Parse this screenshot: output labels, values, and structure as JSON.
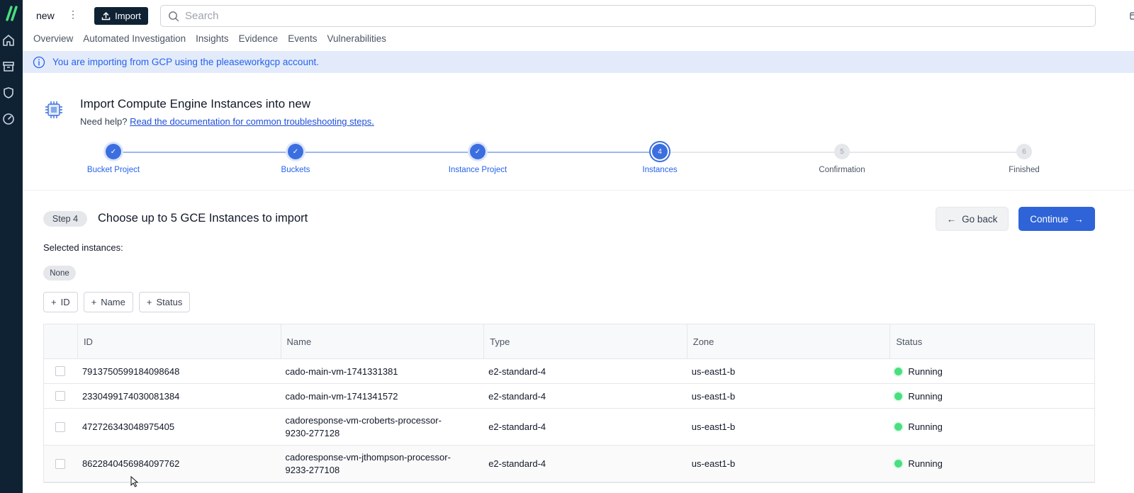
{
  "sidebar": {
    "logo_icon": "cado-logo-icon",
    "items": [
      {
        "icon": "home-icon"
      },
      {
        "icon": "archive-icon"
      },
      {
        "icon": "shield-icon"
      },
      {
        "icon": "gauge-icon"
      }
    ]
  },
  "topbar": {
    "workspace": "new",
    "import_label": "Import",
    "search_placeholder": "Search"
  },
  "tabs": [
    "Overview",
    "Automated Investigation",
    "Insights",
    "Evidence",
    "Events",
    "Vulnerabilities"
  ],
  "banner": {
    "text": "You are importing from GCP using the pleaseworkgcp account."
  },
  "header": {
    "title": "Import Compute Engine Instances into new",
    "help_prefix": "Need help?",
    "help_link": "Read the documentation for common troubleshooting steps."
  },
  "stepper": {
    "steps": [
      {
        "number": "1",
        "label": "Bucket Project",
        "state": "done"
      },
      {
        "number": "2",
        "label": "Buckets",
        "state": "done"
      },
      {
        "number": "3",
        "label": "Instance Project",
        "state": "done"
      },
      {
        "number": "4",
        "label": "Instances",
        "state": "current"
      },
      {
        "number": "5",
        "label": "Confirmation",
        "state": "todo"
      },
      {
        "number": "6",
        "label": "Finished",
        "state": "todo"
      }
    ]
  },
  "step_section": {
    "badge": "Step 4",
    "title": "Choose up to 5 GCE Instances to import",
    "back_label": "Go back",
    "continue_label": "Continue",
    "selected_label": "Selected instances:",
    "none_label": "None"
  },
  "filters": [
    "ID",
    "Name",
    "Status"
  ],
  "table": {
    "columns": [
      "ID",
      "Name",
      "Type",
      "Zone",
      "Status"
    ],
    "rows": [
      {
        "id": "7913750599184098648",
        "name": "cado-main-vm-1741331381",
        "type": "e2-standard-4",
        "zone": "us-east1-b",
        "status": "Running"
      },
      {
        "id": "2330499174030081384",
        "name": "cado-main-vm-1741341572",
        "type": "e2-standard-4",
        "zone": "us-east1-b",
        "status": "Running"
      },
      {
        "id": "472726343048975405",
        "name": "cadoresponse-vm-croberts-processor-9230-277128",
        "type": "e2-standard-4",
        "zone": "us-east1-b",
        "status": "Running"
      },
      {
        "id": "8622840456984097762",
        "name": "cadoresponse-vm-jthompson-processor-9233-277108",
        "type": "e2-standard-4",
        "zone": "us-east1-b",
        "status": "Running"
      }
    ]
  },
  "colors": {
    "sidebar_bg": "#0f2233",
    "accent": "#2f63d8",
    "banner_bg": "#e3ebfb",
    "running": "#4ade80"
  }
}
